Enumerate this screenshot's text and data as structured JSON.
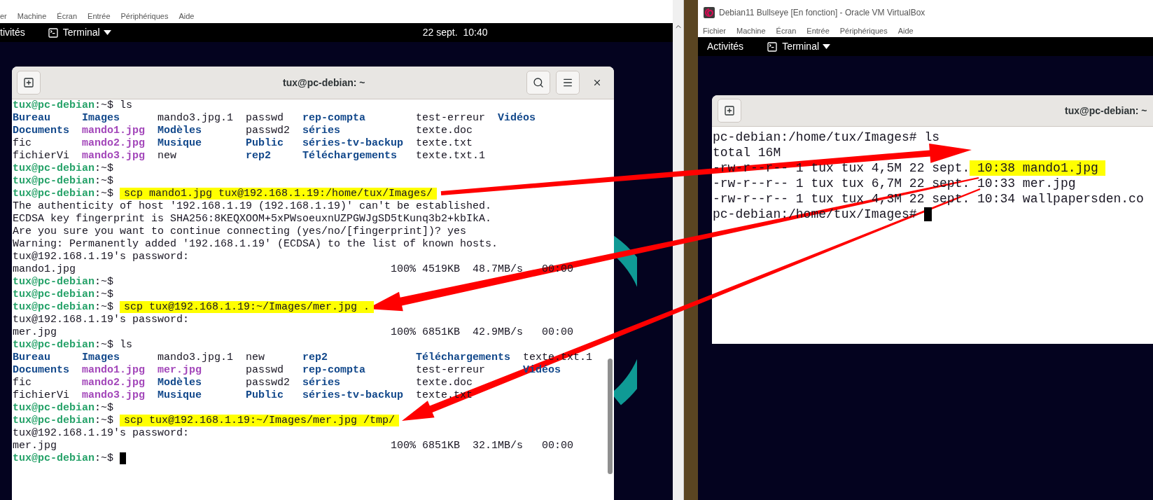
{
  "left_vm": {
    "menu": [
      "er",
      "Machine",
      "Écran",
      "Entrée",
      "Périphériques",
      "Aide"
    ],
    "topbar": {
      "activities": "tivités",
      "app": "Terminal",
      "date": "22 sept.",
      "time": "10:40"
    },
    "terminal": {
      "title": "tux@pc-debian: ~",
      "lines": [
        {
          "kind": "prompt",
          "user": "tux@pc-debian",
          "suffix": ":~$",
          "command": "ls",
          "highlight": false,
          "cursor": false
        },
        {
          "kind": "ls",
          "rows": [
            [
              {
                "text": "Bureau",
                "kind": "dir"
              },
              {
                "text": "Images",
                "kind": "dir"
              },
              {
                "text": "mando3.jpg.1",
                "kind": "file"
              },
              {
                "text": "passwd",
                "kind": "file"
              },
              {
                "text": "rep-compta",
                "kind": "dir"
              },
              {
                "text": "test-erreur",
                "kind": "file"
              },
              {
                "text": "Vidéos",
                "kind": "dir"
              }
            ],
            [
              {
                "text": "Documents",
                "kind": "dir"
              },
              {
                "text": "mando1.jpg",
                "kind": "image"
              },
              {
                "text": "Modèles",
                "kind": "dir"
              },
              {
                "text": "passwd2",
                "kind": "file"
              },
              {
                "text": "séries",
                "kind": "dir"
              },
              {
                "text": "texte.doc",
                "kind": "file"
              }
            ],
            [
              {
                "text": "fic",
                "kind": "file"
              },
              {
                "text": "mando2.jpg",
                "kind": "image"
              },
              {
                "text": "Musique",
                "kind": "dir"
              },
              {
                "text": "Public",
                "kind": "dir"
              },
              {
                "text": "séries-tv-backup",
                "kind": "dir"
              },
              {
                "text": "texte.txt",
                "kind": "file"
              }
            ],
            [
              {
                "text": "fichierVi",
                "kind": "file"
              },
              {
                "text": "mando3.jpg",
                "kind": "image"
              },
              {
                "text": "new",
                "kind": "file"
              },
              {
                "text": "rep2",
                "kind": "dir"
              },
              {
                "text": "Téléchargements",
                "kind": "dir"
              },
              {
                "text": "texte.txt.1",
                "kind": "file"
              }
            ]
          ]
        },
        {
          "kind": "prompt",
          "user": "tux@pc-debian",
          "suffix": ":~$",
          "cursor": false
        },
        {
          "kind": "prompt",
          "user": "tux@pc-debian",
          "suffix": ":~$",
          "cursor": false
        },
        {
          "kind": "prompt",
          "user": "tux@pc-debian",
          "suffix": ":~$",
          "command": "scp mando1.jpg tux@192.168.1.19:/home/tux/Images/",
          "highlight": true,
          "cursor": false
        },
        {
          "kind": "output",
          "text": "The authenticity of host '192.168.1.19 (192.168.1.19)' can't be established."
        },
        {
          "kind": "output",
          "text": "ECDSA key fingerprint is SHA256:8KEQXOOM+5xPWsoeuxnUZPGWJgSD5tKunq3b2+kbIkA."
        },
        {
          "kind": "output",
          "text": "Are you sure you want to continue connecting (yes/no/[fingerprint])? yes"
        },
        {
          "kind": "output",
          "text": "Warning: Permanently added '192.168.1.19' (ECDSA) to the list of known hosts."
        },
        {
          "kind": "output",
          "text": "tux@192.168.1.19's password:"
        },
        {
          "kind": "transfer",
          "file": "mando1.jpg",
          "percent": "100%",
          "size": "4519KB",
          "speed": "48.7MB/s",
          "eta": "00:00"
        },
        {
          "kind": "prompt",
          "user": "tux@pc-debian",
          "suffix": ":~$",
          "cursor": false
        },
        {
          "kind": "prompt",
          "user": "tux@pc-debian",
          "suffix": ":~$",
          "cursor": false
        },
        {
          "kind": "prompt",
          "user": "tux@pc-debian",
          "suffix": ":~$",
          "command": "scp tux@192.168.1.19:~/Images/mer.jpg .",
          "highlight": true,
          "cursor": false
        },
        {
          "kind": "output",
          "text": "tux@192.168.1.19's password:"
        },
        {
          "kind": "transfer",
          "file": "mer.jpg",
          "percent": "100%",
          "size": "6851KB",
          "speed": "42.9MB/s",
          "eta": "00:00"
        },
        {
          "kind": "prompt",
          "user": "tux@pc-debian",
          "suffix": ":~$",
          "command": "ls",
          "highlight": false,
          "cursor": false
        },
        {
          "kind": "ls",
          "rows": [
            [
              {
                "text": "Bureau",
                "kind": "dir"
              },
              {
                "text": "Images",
                "kind": "dir"
              },
              {
                "text": "mando3.jpg.1",
                "kind": "file"
              },
              {
                "text": "new",
                "kind": "file"
              },
              {
                "text": "rep2",
                "kind": "dir"
              },
              {
                "text": "Téléchargements",
                "kind": "dir"
              },
              {
                "text": "texte.txt.1",
                "kind": "file"
              }
            ],
            [
              {
                "text": "Documents",
                "kind": "dir"
              },
              {
                "text": "mando1.jpg",
                "kind": "image"
              },
              {
                "text": "mer.jpg",
                "kind": "image"
              },
              {
                "text": "passwd",
                "kind": "file"
              },
              {
                "text": "rep-compta",
                "kind": "dir"
              },
              {
                "text": "test-erreur",
                "kind": "file"
              },
              {
                "text": "Vidéos",
                "kind": "dir"
              }
            ],
            [
              {
                "text": "fic",
                "kind": "file"
              },
              {
                "text": "mando2.jpg",
                "kind": "image"
              },
              {
                "text": "Modèles",
                "kind": "dir"
              },
              {
                "text": "passwd2",
                "kind": "file"
              },
              {
                "text": "séries",
                "kind": "dir"
              },
              {
                "text": "texte.doc",
                "kind": "file"
              }
            ],
            [
              {
                "text": "fichierVi",
                "kind": "file"
              },
              {
                "text": "mando3.jpg",
                "kind": "image"
              },
              {
                "text": "Musique",
                "kind": "dir"
              },
              {
                "text": "Public",
                "kind": "dir"
              },
              {
                "text": "séries-tv-backup",
                "kind": "dir"
              },
              {
                "text": "texte.txt",
                "kind": "file"
              }
            ]
          ]
        },
        {
          "kind": "prompt",
          "user": "tux@pc-debian",
          "suffix": ":~$",
          "cursor": false
        },
        {
          "kind": "prompt",
          "user": "tux@pc-debian",
          "suffix": ":~$",
          "command": "scp tux@192.168.1.19:~/Images/mer.jpg /tmp/",
          "highlight": true,
          "cursor": false
        },
        {
          "kind": "output",
          "text": "tux@192.168.1.19's password:"
        },
        {
          "kind": "transfer",
          "file": "mer.jpg",
          "percent": "100%",
          "size": "6851KB",
          "speed": "32.1MB/s",
          "eta": "00:00"
        },
        {
          "kind": "prompt",
          "user": "tux@pc-debian",
          "suffix": ":~$",
          "cursor": true
        }
      ]
    }
  },
  "right_vm": {
    "title": "Debian11 Bullseye [En fonction] - Oracle VM VirtualBox",
    "menu": [
      "Fichier",
      "Machine",
      "Écran",
      "Entrée",
      "Périphériques",
      "Aide"
    ],
    "topbar": {
      "activities": "Activités",
      "app": "Terminal"
    },
    "terminal": {
      "title": "tux@pc-debian: ~",
      "lines": [
        {
          "segments": [
            {
              "text": "pc-debian:/home/tux/Images# ls",
              "highlight": false
            }
          ],
          "cursor": false
        },
        {
          "segments": [
            {
              "text": "total 16M",
              "highlight": false
            }
          ],
          "cursor": false
        },
        {
          "segments": [
            {
              "text": "-rw-r--r-- 1 tux tux 4,5M 22 sept.",
              "highlight": false
            },
            {
              "text": "10:38 mando1.jpg",
              "highlight": true
            }
          ],
          "cursor": false
        },
        {
          "segments": [
            {
              "text": "-rw-r--r-- 1 tux tux 6,7M 22 sept. 10:33 mer.jpg",
              "highlight": false
            }
          ],
          "cursor": false
        },
        {
          "segments": [
            {
              "text": "-rw-r--r-- 1 tux tux 4,3M 22 sept. 10:34 wallpapersden.co",
              "highlight": false
            }
          ],
          "cursor": false
        },
        {
          "segments": [
            {
              "text": "pc-debian:/home/tux/Images#",
              "highlight": false
            }
          ],
          "cursor": true
        }
      ]
    }
  }
}
